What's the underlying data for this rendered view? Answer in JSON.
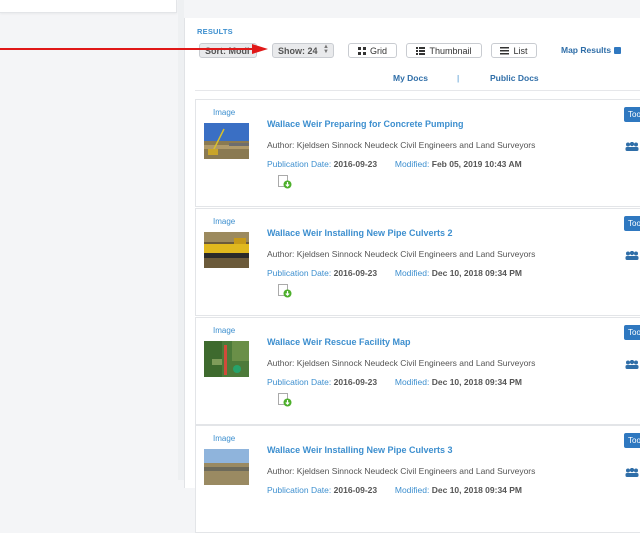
{
  "results": {
    "heading": "RESULTS",
    "controls": {
      "sort_label": "Sort: Modi",
      "show_label": "Show: 24",
      "grid_label": "Grid",
      "thumbnail_label": "Thumbnail",
      "list_label": "List",
      "map_results_label": "Map Results",
      "map_results_checked": true
    },
    "tabs": {
      "my_docs": "My Docs",
      "separator": "|",
      "public_docs": "Public Docs"
    },
    "items": [
      {
        "type": "Image",
        "title": "Wallace Weir Preparing for Concrete Pumping",
        "author": "Author: Kjeldsen Sinnock Neudeck Civil Engineers and Land Surveyors",
        "pub_label": "Publication Date:",
        "pub_date": "2016-09-23",
        "mod_label": "Modified:",
        "mod_date": "Feb 05, 2019 10:43 AM",
        "tool_label": "Too"
      },
      {
        "type": "Image",
        "title": "Wallace Weir Installing New Pipe Culverts 2",
        "author": "Author: Kjeldsen Sinnock Neudeck Civil Engineers and Land Surveyors",
        "pub_label": "Publication Date:",
        "pub_date": "2016-09-23",
        "mod_label": "Modified:",
        "mod_date": "Dec 10, 2018 09:34 PM",
        "tool_label": "Too"
      },
      {
        "type": "Image",
        "title": "Wallace Weir Rescue Facility Map",
        "author": "Author: Kjeldsen Sinnock Neudeck Civil Engineers and Land Surveyors",
        "pub_label": "Publication Date:",
        "pub_date": "2016-09-23",
        "mod_label": "Modified:",
        "mod_date": "Dec 10, 2018 09:34 PM",
        "tool_label": "Too"
      },
      {
        "type": "Image",
        "title": "Wallace Weir Installing New Pipe Culverts 3",
        "author": "Author: Kjeldsen Sinnock Neudeck Civil Engineers and Land Surveyors",
        "pub_label": "Publication Date:",
        "pub_date": "2016-09-23",
        "mod_label": "Modified:",
        "mod_date": "Dec 10, 2018 09:34 PM",
        "tool_label": "Too"
      }
    ]
  },
  "icons": {
    "grid": "grid-icon",
    "thumbnail": "thumbnail-icon",
    "list": "list-icon",
    "download": "download-icon",
    "people": "people-icon",
    "arrow": "red-arrow-annotation"
  },
  "colors": {
    "accent": "#3d8fcf",
    "link_dark": "#2f6ea8",
    "button": "#2f78c0",
    "arrow": "#e01818",
    "download_green": "#4caf2a"
  }
}
